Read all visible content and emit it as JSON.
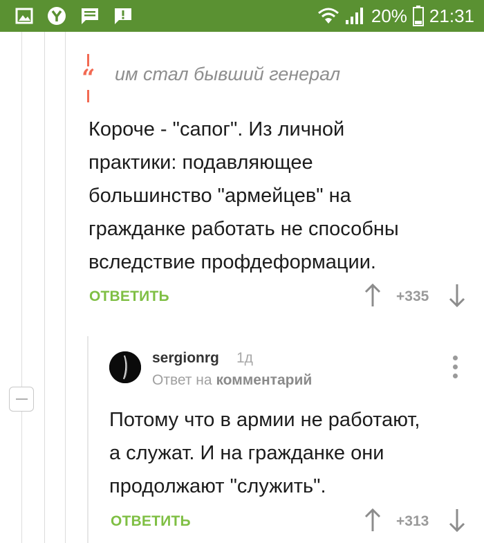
{
  "status_bar": {
    "battery_percent": "20%",
    "time": "21:31",
    "icons": [
      "image-icon",
      "yandex-icon",
      "message-icon",
      "alert-icon",
      "wifi-icon",
      "signal-icon",
      "battery-icon"
    ],
    "background": "#5a9132"
  },
  "comment1": {
    "quote": "им стал бывший генерал",
    "body_lines": [
      "Короче - \"сапог\". Из личной",
      "практики: подавляющее",
      "большинство \"армейцев\" на",
      "гражданке работать не способны",
      "вследствие профдеформации."
    ],
    "reply_label": "ОТВЕТИТЬ",
    "rating": "+335"
  },
  "comment2": {
    "username": "sergionrg",
    "time": "1д",
    "reply_to_prefix": "Ответ на",
    "reply_to_link": "комментарий",
    "body_lines": [
      "Потому что в армии не работают,",
      "а служат. И на гражданке они",
      "продолжают \"служить\"."
    ],
    "reply_label": "ОТВЕТИТЬ",
    "rating": "+313"
  },
  "colors": {
    "accent_green": "#7fbf44",
    "quote_red": "#f26a53",
    "text": "#1c1c1c",
    "muted": "#9a9a9a"
  }
}
